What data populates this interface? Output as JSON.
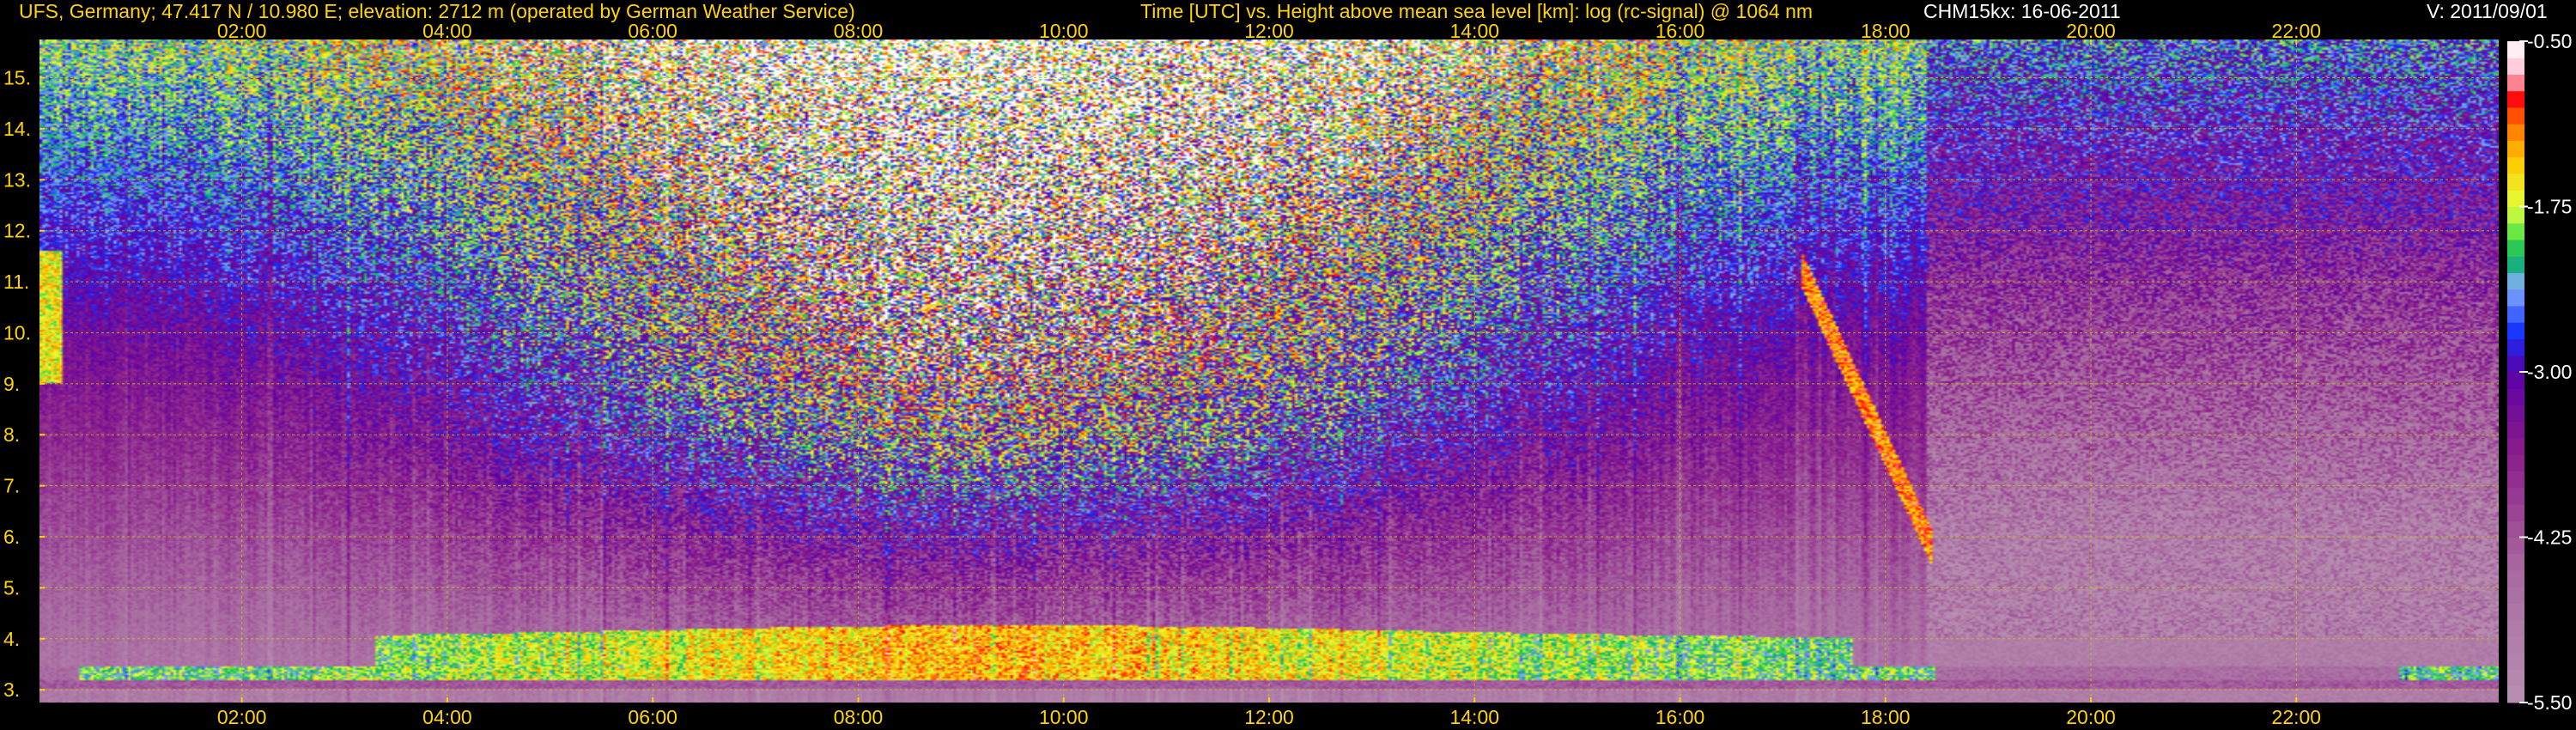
{
  "header": {
    "station": "UFS, Germany; 47.417 N / 10.980 E; elevation: 2712 m  (operated by German Weather Service)",
    "axes_title": "Time [UTC] vs. Height above mean sea level [km]: log (rc-signal) @ 1064 nm",
    "instrument_date": "CHM15kx: 16-06-2011",
    "version": "V: 2011/09/01"
  },
  "colors": {
    "background": "#000000",
    "label_yellow": "#ffd400",
    "grid_yellow": "#c8c800",
    "label_white": "#ffffff"
  },
  "chart_data": {
    "type": "heatmap",
    "title": "Time [UTC] vs. Height above mean sea level [km]: log (rc-signal) @ 1064 nm",
    "xlabel": "Time [UTC]",
    "ylabel": "Height above mean sea level [km]",
    "x_ticks": [
      "02:00",
      "04:00",
      "06:00",
      "08:00",
      "10:00",
      "12:00",
      "14:00",
      "16:00",
      "18:00",
      "20:00",
      "22:00"
    ],
    "x_tick_hours": [
      2,
      4,
      6,
      8,
      10,
      12,
      14,
      16,
      18,
      20,
      22
    ],
    "xlim_hours": [
      0.03,
      23.97
    ],
    "y_ticks": [
      "3.",
      "4.",
      "5.",
      "6.",
      "7.",
      "8.",
      "9.",
      "10.",
      "11.",
      "12.",
      "13.",
      "14.",
      "15."
    ],
    "y_tick_values": [
      3,
      4,
      5,
      6,
      7,
      8,
      9,
      10,
      11,
      12,
      13,
      14,
      15
    ],
    "ylim_km": [
      2.75,
      15.75
    ],
    "grid": true,
    "colorbar": {
      "tick_labels": [
        "-0.50",
        "-1.75",
        "-3.00",
        "-4.25",
        "-5.50"
      ],
      "tick_values": [
        -0.5,
        -1.75,
        -3.0,
        -4.25,
        -5.5
      ],
      "range": [
        -5.5,
        -0.5
      ],
      "stops": [
        {
          "v": -5.5,
          "c": "#b890b0"
        },
        {
          "v": -4.5,
          "c": "#a86aa0"
        },
        {
          "v": -3.6,
          "c": "#8a1c8a"
        },
        {
          "v": -3.0,
          "c": "#5a00a6"
        },
        {
          "v": -2.7,
          "c": "#1432ff"
        },
        {
          "v": -2.35,
          "c": "#8ab0ff"
        },
        {
          "v": -2.15,
          "c": "#00b060"
        },
        {
          "v": -1.95,
          "c": "#64e646"
        },
        {
          "v": -1.75,
          "c": "#e6ff3c"
        },
        {
          "v": -1.4,
          "c": "#ffc800"
        },
        {
          "v": -1.1,
          "c": "#ff6a00"
        },
        {
          "v": -0.95,
          "c": "#ff0000"
        },
        {
          "v": -0.75,
          "c": "#ffbed2"
        },
        {
          "v": -0.5,
          "c": "#ffffff"
        }
      ]
    }
  }
}
